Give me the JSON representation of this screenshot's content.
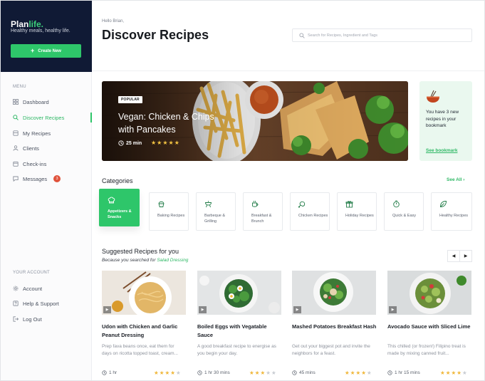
{
  "brand": {
    "name_main": "Plan",
    "name_accent": "life.",
    "tagline": "Healthy meals, healthy life.",
    "create_label": "Create New",
    "accent": "#2ec66a"
  },
  "sidebar": {
    "menu_heading": "MENU",
    "items": [
      {
        "label": "Dashboard",
        "icon": "grid-icon"
      },
      {
        "label": "Discover Recipes",
        "icon": "search-icon",
        "active": true
      },
      {
        "label": "My Recipes",
        "icon": "book-icon"
      },
      {
        "label": "Clients",
        "icon": "user-icon"
      },
      {
        "label": "Check-ins",
        "icon": "calendar-icon"
      },
      {
        "label": "Messages",
        "icon": "message-icon",
        "badge": "3"
      }
    ],
    "account_heading": "YOUR ACCOUNT",
    "account_items": [
      {
        "label": "Account",
        "icon": "gear-icon"
      },
      {
        "label": "Help & Support",
        "icon": "help-icon"
      },
      {
        "label": "Log Out",
        "icon": "logout-icon"
      }
    ]
  },
  "header": {
    "greeting": "Hello Brian,",
    "title": "Discover Recipes",
    "search_placeholder": "Search for Recipes, Ingredient and Tags"
  },
  "hero": {
    "badge": "POPULAR",
    "title": "Vegan: Chicken & Chips with Pancakes",
    "time": "25 min",
    "rating": 5
  },
  "bookmark": {
    "text": "You have 3 new recipes in your bookmark",
    "link": "See bookmark"
  },
  "categories": {
    "title": "Categories",
    "see_all": "See All",
    "items": [
      {
        "label": "Appetizers & Snacks",
        "icon": "chef-hat-icon",
        "active": true
      },
      {
        "label": "Baking Recipes",
        "icon": "cupcake-icon"
      },
      {
        "label": "Barbeque & Grilling",
        "icon": "grill-icon"
      },
      {
        "label": "Breakfast & Brunch",
        "icon": "coffee-icon"
      },
      {
        "label": "Chicken Recipes",
        "icon": "chicken-icon"
      },
      {
        "label": "Holiday Recipes",
        "icon": "gift-icon"
      },
      {
        "label": "Quick & Easy",
        "icon": "timer-icon"
      },
      {
        "label": "Healthy Recipes",
        "icon": "leaf-icon"
      }
    ]
  },
  "suggested": {
    "title": "Suggested Recipes for you",
    "because_prefix": "Because you searched for",
    "because_term": "Salad Dressing",
    "cards": [
      {
        "title": "Udon with Chicken and Garlic Peanut Dressing",
        "desc": "Prep fava beans once, eat them for days on ricotta topped toast, cream...",
        "time": "1 hr",
        "rating": 4
      },
      {
        "title": "Boiled Eggs with Vegatable Sauce",
        "desc": "A good breakfast recipe to energise as you begin your day.",
        "time": "1 hr 30 mins",
        "rating": 3
      },
      {
        "title": "Mashed Potatoes Breakfast Hash",
        "desc": "Get out your biggest pot and invite the neighbors for a feast.",
        "time": "45 mins",
        "rating": 4
      },
      {
        "title": "Avocado Sauce with Sliced Lime",
        "desc": "This chilled (or frozen!) Filipino treat is made by mixing canned fruit...",
        "time": "1 hr 15 mins",
        "rating": 4
      }
    ]
  }
}
